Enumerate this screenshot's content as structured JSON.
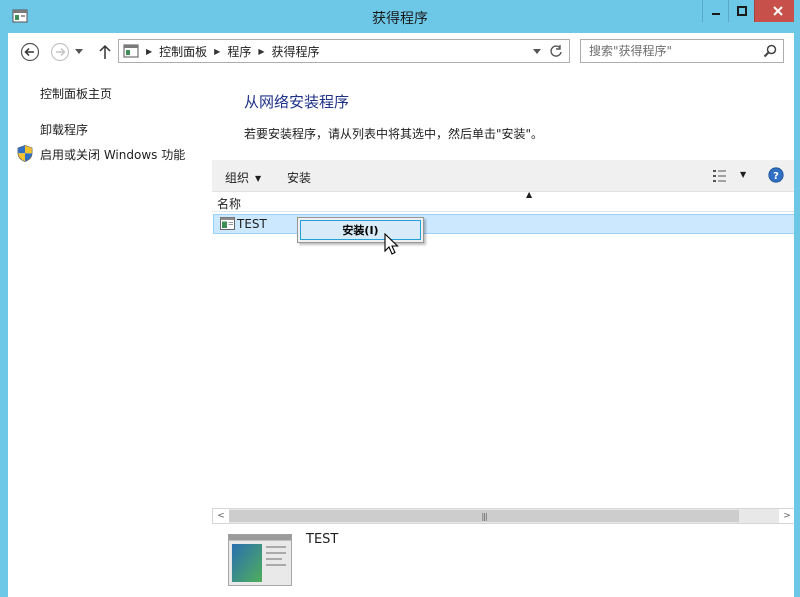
{
  "window": {
    "title": "获得程序"
  },
  "address": {
    "crumbs": [
      "控制面板",
      "程序",
      "获得程序"
    ]
  },
  "search": {
    "placeholder": "搜索\"获得程序\""
  },
  "sidebar": {
    "links": [
      "控制面板主页",
      "卸载程序",
      "启用或关闭 Windows 功能"
    ]
  },
  "main": {
    "heading": "从网络安装程序",
    "description": "若要安装程序，请从列表中将其选中，然后单击\"安装\"。"
  },
  "toolbar": {
    "organize_label": "组织",
    "install_label": "安装"
  },
  "list": {
    "column_name": "名称",
    "items": [
      {
        "label": "TEST"
      }
    ]
  },
  "context_menu": {
    "items": [
      "安装(I)"
    ]
  },
  "details": {
    "name": "TEST"
  },
  "colors": {
    "titlebar": "#6dc8e8",
    "link": "#1e3287",
    "selection": "#cce8ff",
    "close_button": "#c7504a"
  },
  "icons": [
    "window-app-icon",
    "minimize-icon",
    "maximize-icon",
    "close-icon",
    "back-icon",
    "forward-icon",
    "up-icon",
    "refresh-icon",
    "search-icon",
    "shield-icon",
    "view-icon",
    "help-icon",
    "program-icon",
    "cursor-icon"
  ]
}
